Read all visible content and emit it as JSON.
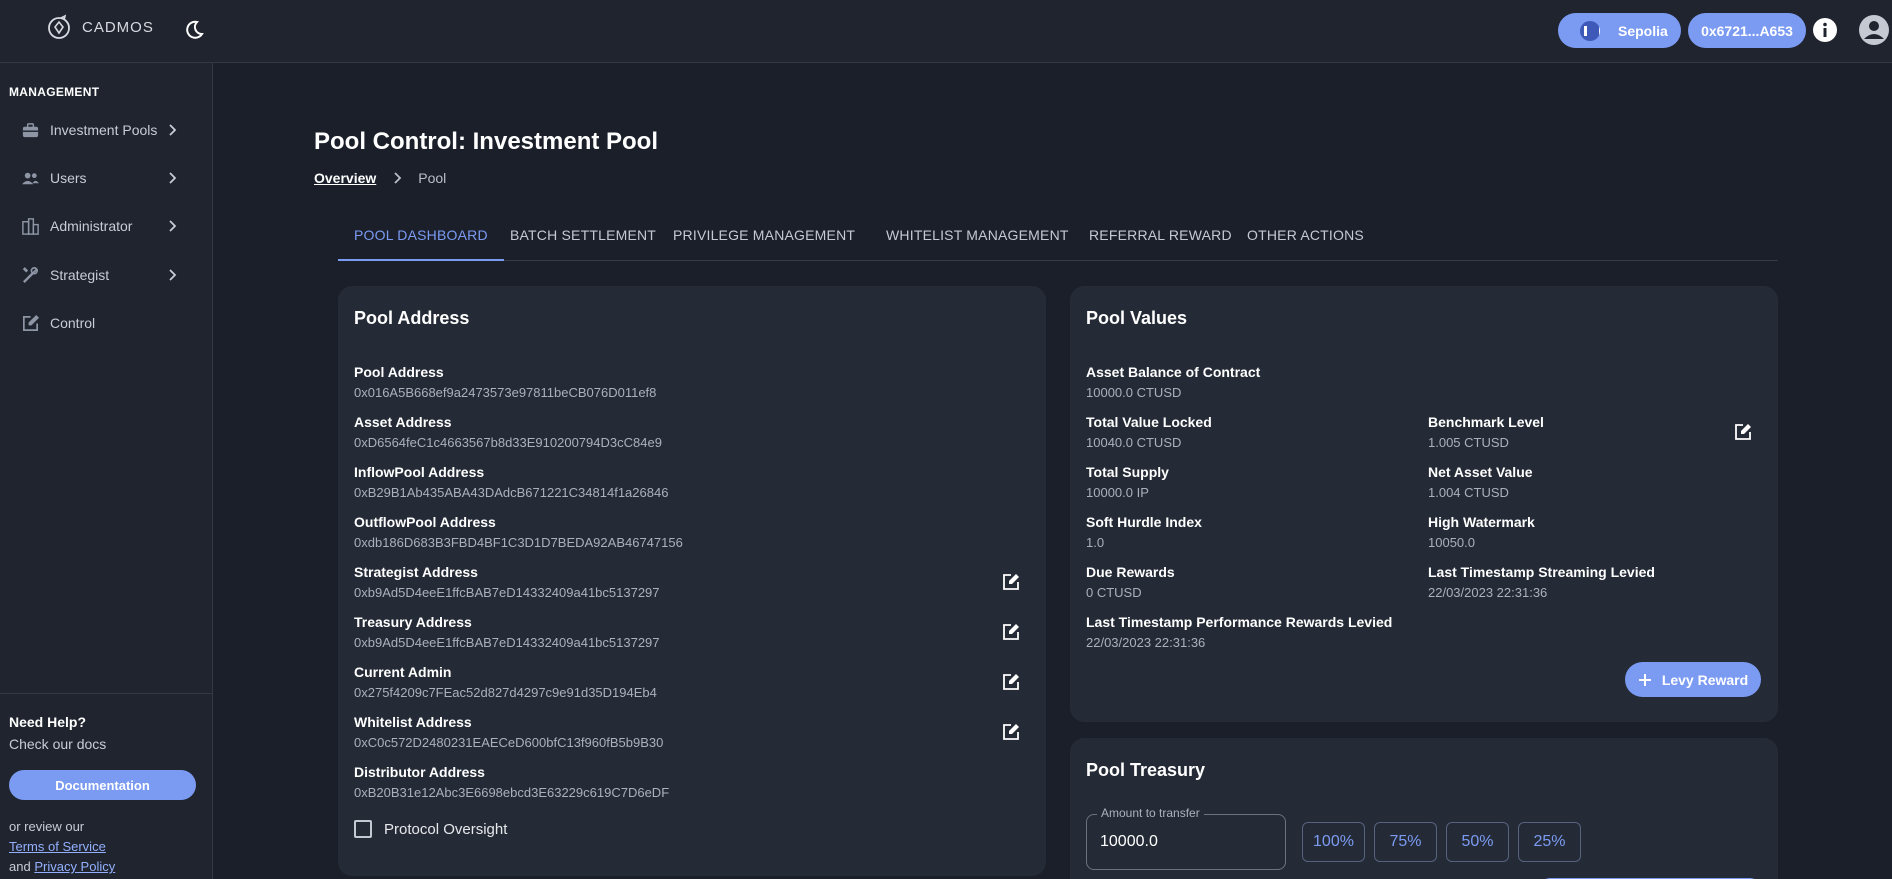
{
  "app": {
    "brand": "CADMOS"
  },
  "header": {
    "network_label": "Sepolia",
    "account_label": "0x6721...A653"
  },
  "sidebar": {
    "section_title": "MANAGEMENT",
    "items": [
      {
        "label": "Investment Pools",
        "icon": "briefcase-icon",
        "has_chevron": true
      },
      {
        "label": "Users",
        "icon": "users-icon",
        "has_chevron": true
      },
      {
        "label": "Administrator",
        "icon": "admin-icon",
        "has_chevron": true
      },
      {
        "label": "Strategist",
        "icon": "tools-icon",
        "has_chevron": true
      },
      {
        "label": "Control",
        "icon": "edit-icon",
        "has_chevron": false
      }
    ],
    "help": {
      "title": "Need Help?",
      "subtitle": "Check our docs",
      "doc_button": "Documentation",
      "review_text": "or review our",
      "terms_link": "Terms of Service",
      "and_text": "and",
      "privacy_link": "Privacy Policy"
    }
  },
  "page": {
    "title": "Pool Control: Investment Pool",
    "breadcrumb": {
      "root": "Overview",
      "current": "Pool"
    },
    "tabs": [
      "POOL DASHBOARD",
      "BATCH SETTLEMENT",
      "PRIVILEGE MANAGEMENT",
      "WHITELIST MANAGEMENT",
      "REFERRAL REWARD",
      "OTHER ACTIONS"
    ],
    "active_tab": "POOL DASHBOARD"
  },
  "pool_address_card": {
    "title": "Pool Address",
    "fields": [
      {
        "label": "Pool Address",
        "value": "0x016A5B668ef9a2473573e97811beCB076D011ef8",
        "editable": false
      },
      {
        "label": "Asset Address",
        "value": "0xD6564feC1c4663567b8d33E910200794D3cC84e9",
        "editable": false
      },
      {
        "label": "InflowPool Address",
        "value": "0xB29B1Ab435ABA43DAdcB671221C34814f1a26846",
        "editable": false
      },
      {
        "label": "OutflowPool Address",
        "value": "0xdb186D683B3FBD4BF1C3D1D7BEDA92AB46747156",
        "editable": false
      },
      {
        "label": "Strategist Address",
        "value": "0xb9Ad5D4eeE1ffcBAB7eD14332409a41bc5137297",
        "editable": true
      },
      {
        "label": "Treasury Address",
        "value": "0xb9Ad5D4eeE1ffcBAB7eD14332409a41bc5137297",
        "editable": true
      },
      {
        "label": "Current Admin",
        "value": "0x275f4209c7FEac52d827d4297c9e91d35D194Eb4",
        "editable": true
      },
      {
        "label": "Whitelist Address",
        "value": "0xC0c572D2480231EAECeD600bfC13f960fB5b9B30",
        "editable": true
      },
      {
        "label": "Distributor Address",
        "value": "0xB20B31e12Abc3E6698ebcd3E63229c619C7D6eDF",
        "editable": false
      }
    ],
    "checkbox_label": "Protocol Oversight",
    "checkbox_checked": false
  },
  "pool_values_card": {
    "title": "Pool Values",
    "fields": [
      {
        "label": "Asset Balance of Contract",
        "value": "10000.0 CTUSD"
      },
      {
        "label": "Total Value Locked",
        "value": "10040.0 CTUSD"
      },
      {
        "label": "Benchmark Level",
        "value": "1.005 CTUSD",
        "editable": true
      },
      {
        "label": "Total Supply",
        "value": "10000.0 IP"
      },
      {
        "label": "Net Asset Value",
        "value": "1.004 CTUSD"
      },
      {
        "label": "Soft Hurdle Index",
        "value": "1.0"
      },
      {
        "label": "High Watermark",
        "value": "10050.0"
      },
      {
        "label": "Due Rewards",
        "value": "0 CTUSD"
      },
      {
        "label": "Last Timestamp Streaming Levied",
        "value": "22/03/2023 22:31:36"
      },
      {
        "label": "Last Timestamp Performance Rewards Levied",
        "value": "22/03/2023 22:31:36"
      }
    ],
    "levy_button": "Levy Reward"
  },
  "pool_treasury_card": {
    "title": "Pool Treasury",
    "amount_label": "Amount to transfer",
    "amount_value": "10000.0",
    "percent_buttons": [
      "100%",
      "75%",
      "50%",
      "25%"
    ]
  },
  "colors": {
    "accent": "#7b9bf3",
    "background": "#1a1f29",
    "card": "#252b36"
  }
}
